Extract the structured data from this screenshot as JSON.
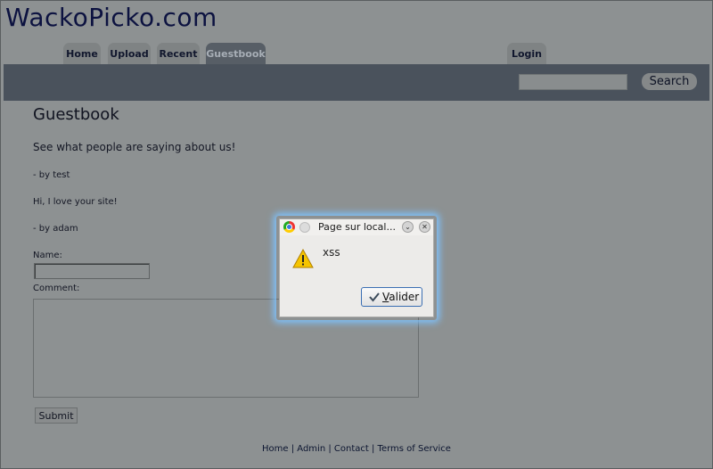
{
  "site": {
    "logo": "WackoPicko.com"
  },
  "nav": {
    "tabs": [
      {
        "label": "Home"
      },
      {
        "label": "Upload"
      },
      {
        "label": "Recent"
      },
      {
        "label": "Guestbook"
      }
    ],
    "login": "Login",
    "search_button": "Search",
    "search_value": ""
  },
  "page": {
    "title": "Guestbook",
    "intro": "See what people are saying about us!",
    "entries": [
      {
        "text": "- by test"
      },
      {
        "text": "Hi, I love your site!"
      },
      {
        "text": "- by adam"
      }
    ],
    "form": {
      "name_label": "Name:",
      "name_value": "",
      "comment_label": "Comment:",
      "comment_value": "",
      "submit_label": "Submit"
    }
  },
  "footer": {
    "links": [
      "Home",
      "Admin",
      "Contact",
      "Terms of Service"
    ],
    "separator": " | "
  },
  "dialog": {
    "title": "Page sur local...",
    "message": "xss",
    "button_accesskey": "V",
    "button_rest": "alider",
    "border_glow": "#7ec3ff"
  }
}
